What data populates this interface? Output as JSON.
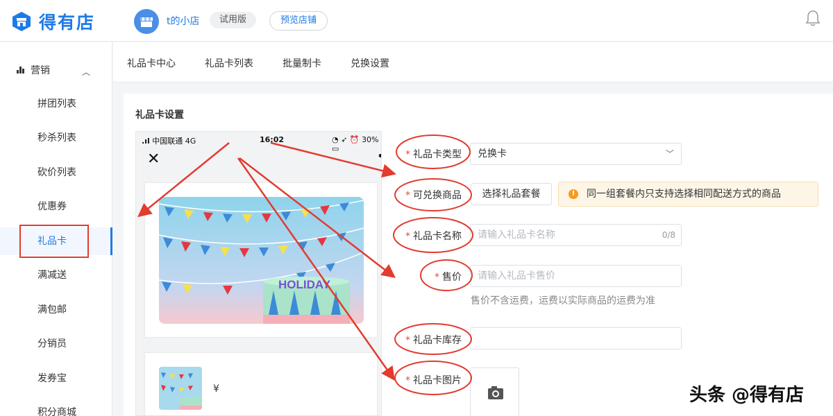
{
  "brand": {
    "name": "得有店",
    "color": "#1e7ae6"
  },
  "header": {
    "shop_name": "t的小店",
    "trial_badge": "试用版",
    "preview_button": "预览店铺",
    "icons": [
      "store-logo-icon",
      "shop-avatar",
      "bell-icon"
    ]
  },
  "sidebar": {
    "section": "营销",
    "items": [
      {
        "label": "拼团列表"
      },
      {
        "label": "秒杀列表"
      },
      {
        "label": "砍价列表"
      },
      {
        "label": "优惠券"
      },
      {
        "label": "礼品卡",
        "active": true
      },
      {
        "label": "满减送"
      },
      {
        "label": "满包邮"
      },
      {
        "label": "分销员"
      },
      {
        "label": "发券宝"
      },
      {
        "label": "积分商城"
      }
    ]
  },
  "tabs": [
    {
      "label": "礼品卡中心"
    },
    {
      "label": "礼品卡列表"
    },
    {
      "label": "批量制卡"
    },
    {
      "label": "兑换设置"
    }
  ],
  "panel": {
    "title": "礼品卡设置"
  },
  "phone": {
    "carrier": "中国联通  4G",
    "time": "16:02",
    "battery": "30%",
    "close": "✕",
    "more": "•••",
    "card_text": "HOLIDAY",
    "price_symbol": "¥"
  },
  "form": {
    "required_mark": "*",
    "type": {
      "label": "礼品卡类型",
      "value": "兑换卡"
    },
    "goods": {
      "label": "可兑换商品",
      "button": "选择礼品套餐",
      "notice": "同一组套餐内只支持选择相同配送方式的商品"
    },
    "name": {
      "label": "礼品卡名称",
      "placeholder": "请输入礼品卡名称",
      "counter": "0/8"
    },
    "price": {
      "label": "售价",
      "placeholder": "请输入礼品卡售价",
      "hint": "售价不含运费，运费以实际商品的运费为准"
    },
    "stock": {
      "label": "礼品卡库存"
    },
    "image": {
      "label": "礼品卡图片"
    }
  },
  "watermark": "头条 @得有店",
  "colors": {
    "accent": "#1e7ae6",
    "annotation_red": "#e23b2f",
    "required": "#e64a3b",
    "notice_bg": "#fdf6e7",
    "warn": "#f59a23"
  }
}
